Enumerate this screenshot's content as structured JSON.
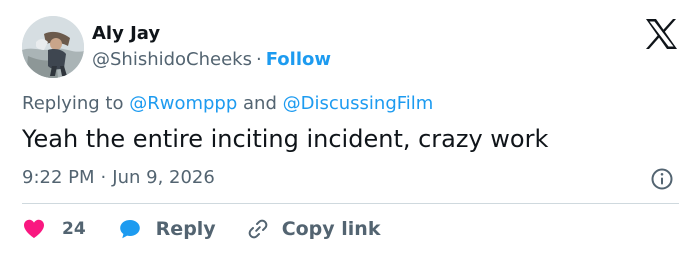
{
  "author": {
    "display_name": "Aly Jay",
    "handle": "@ShishidoCheeks",
    "separator": "·",
    "follow_label": "Follow"
  },
  "reply_context": {
    "prefix": "Replying to",
    "mention_1": "@Rwomppp",
    "conjunction": "and",
    "mention_2": "@DiscussingFilm"
  },
  "tweet": {
    "text": "Yeah the entire inciting incident, crazy work",
    "time": "9:22 PM",
    "separator": "·",
    "date": "Jun 9, 2026"
  },
  "actions": {
    "like_count": "24",
    "reply_label": "Reply",
    "copy_link_label": "Copy link"
  },
  "icons": {
    "logo": "x-logo-icon",
    "info": "info-icon",
    "like": "heart-icon",
    "reply": "speech-bubble-icon",
    "copy": "link-icon"
  },
  "colors": {
    "accent": "#1d9bf0",
    "like": "#f91880",
    "text": "#0f1419",
    "muted": "#536471",
    "divider": "#cfd9de"
  }
}
